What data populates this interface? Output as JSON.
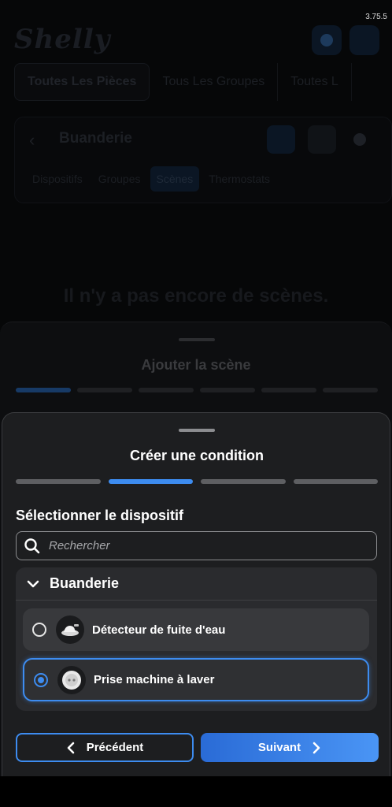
{
  "status": {
    "version": "3.75.5"
  },
  "app": {
    "logo_text": "Shelly",
    "tabs": [
      "Toutes Les Pièces",
      "Tous Les Groupes",
      "Toutes L"
    ],
    "room": {
      "title": "Buanderie",
      "subtabs": [
        "Dispositifs",
        "Groupes",
        "Scènes",
        "Thermostats"
      ],
      "active_subtab": "Scènes"
    },
    "empty_message": "Il n'y a pas encore de scènes."
  },
  "scene_sheet": {
    "title": "Ajouter la scène",
    "step_count": 6,
    "active_step": 1
  },
  "condition_sheet": {
    "title": "Créer une condition",
    "step_count": 4,
    "active_step": 2,
    "section_title": "Sélectionner le dispositif",
    "search_placeholder": "Rechercher",
    "group": {
      "name": "Buanderie",
      "expanded": true,
      "devices": [
        {
          "label": "Détecteur de fuite d'eau",
          "selected": false,
          "icon": "leak-sensor-icon"
        },
        {
          "label": "Prise machine à laver",
          "selected": true,
          "icon": "plug-icon"
        }
      ]
    },
    "prev_label": "Précédent",
    "next_label": "Suivant"
  },
  "colors": {
    "accent": "#3d8cf0",
    "sheet_bg": "#1d1e20",
    "card_bg": "#2a2b2e"
  }
}
